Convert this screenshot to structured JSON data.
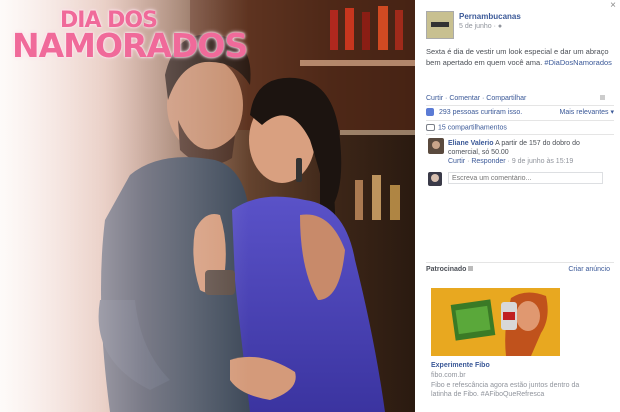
{
  "photo": {
    "logo_line1": "DIA DOS",
    "logo_line2": "NAMORADOS"
  },
  "post": {
    "page_name": "Pernambucanas",
    "date": "5 de junho · ",
    "text": "Sexta é dia de vestir um look especial e dar um abraço bem apertado em quem você ama.",
    "hashtag": "#DiaDosNamorados",
    "actions": "Curtir · Comentar · Compartilhar",
    "likes": "293 pessoas curtiram isso.",
    "relevant": "Mais relevantes ▾",
    "shares": "15 compartilhamentos"
  },
  "comment": {
    "author": "Eliane Valerio",
    "text": " A partir de 157 do dobro do comercial, só 50.00",
    "meta_like": "Curtir",
    "meta_reply": "Responder",
    "meta_time": " · 9 de junho às 15:19"
  },
  "comment_box": {
    "placeholder": "Escreva um comentário..."
  },
  "ads": {
    "sponsored": "Patrocinado",
    "create": "Criar anúncio",
    "title": "Experimente Fibo",
    "domain": "fibo.com.br",
    "description": "Fibo e refescância agora estão juntos dentro da latinha de Fibo. #AFiboQueRefresca"
  },
  "close": "×"
}
